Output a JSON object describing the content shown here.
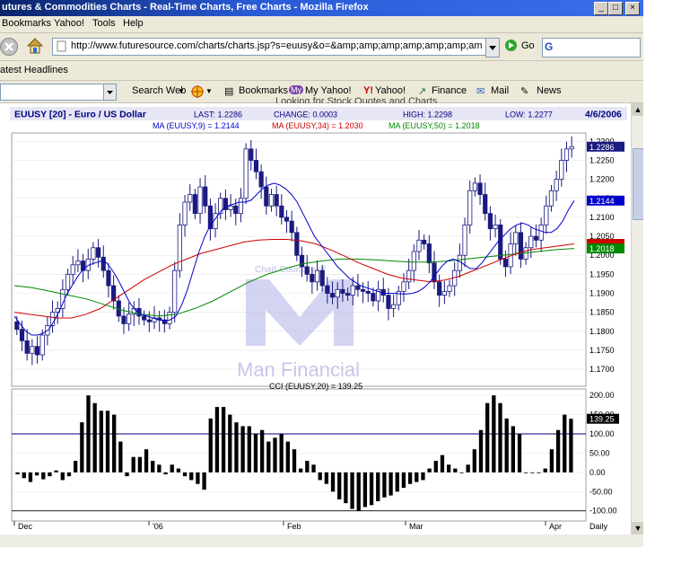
{
  "window": {
    "title": "utures & Commodities Charts - Real-Time Charts, Free Charts - Mozilla Firefox"
  },
  "menu": [
    "Bookmarks",
    "Yahoo!",
    "Tools",
    "Help"
  ],
  "nav": {
    "url": "http://www.futuresource.com/charts/charts.jsp?s=euusy&o=&amp;amp;amp;amp;amp;amp;amp;amp;amp;a=",
    "go_label": "Go"
  },
  "bookmarks_bar": {
    "item": "atest Headlines"
  },
  "yahoo_toolbar": {
    "search_label": "Search Web",
    "items": [
      "Bookmarks",
      "My Yahoo!",
      "Yahoo!",
      "Finance",
      "Mail",
      "News"
    ],
    "hint": "Looking for Stock Quotes and Charts"
  },
  "chart_header": {
    "symbol": "EUUSY [20] - Euro / US Dollar",
    "last": "LAST: 1.2286",
    "change": "CHANGE: 0.0003",
    "high": "HIGH: 1.2298",
    "low": "LOW: 1.2277",
    "date": "4/6/2006",
    "ma9": "MA (EUUSY,9) = 1.2144",
    "ma34": "MA (EUUSY,34) = 1.2030",
    "ma50": "MA (EUUSY,50) = 1.2018"
  },
  "watermark": {
    "line1": "Chart Courtesy of",
    "brand": "Man Financial"
  },
  "cci_label": "CCI (EUUSY,20) = 139.25",
  "colors": {
    "candle": "#1a1a80",
    "ma9": "#0000cc",
    "ma34": "#cc0000",
    "ma50": "#008800",
    "cci": "#000000"
  },
  "chart_data": [
    {
      "type": "candlestick",
      "title": "EUUSY [20] - Euro / US Dollar",
      "y_ticks": [
        "1.2300",
        "1.2250",
        "1.2200",
        "1.2150",
        "1.2100",
        "1.2050",
        "1.2000",
        "1.1950",
        "1.1900",
        "1.1850",
        "1.1800",
        "1.1750",
        "1.1700"
      ],
      "ylim": [
        1.166,
        1.2315
      ],
      "x_ticks": [
        "Dec",
        "'06",
        "Feb",
        "Mar",
        "Apr",
        "Daily"
      ],
      "price_markers": [
        {
          "value": 1.2286,
          "label": "1.2286",
          "color": "#1a1a80"
        },
        {
          "value": 1.2144,
          "label": "1.2144",
          "color": "#0000cc"
        },
        {
          "value": 1.203,
          "label": "",
          "color": "#cc0000"
        },
        {
          "value": 1.2018,
          "label": "1.2018",
          "color": "#008800"
        }
      ],
      "closes": [
        1.1805,
        1.1775,
        1.1742,
        1.176,
        1.1738,
        1.179,
        1.1815,
        1.185,
        1.186,
        1.191,
        1.195,
        1.1975,
        1.1985,
        1.196,
        1.199,
        1.202,
        1.1995,
        1.196,
        1.192,
        1.188,
        1.184,
        1.182,
        1.1845,
        1.186,
        1.184,
        1.183,
        1.1825,
        1.1835,
        1.183,
        1.182,
        1.185,
        1.196,
        1.208,
        1.214,
        1.216,
        1.211,
        1.218,
        1.213,
        1.207,
        1.211,
        1.215,
        1.212,
        1.213,
        1.211,
        1.215,
        1.228,
        1.225,
        1.222,
        1.218,
        1.213,
        1.216,
        1.213,
        1.21,
        1.209,
        1.206,
        1.2,
        1.197,
        1.195,
        1.193,
        1.196,
        1.192,
        1.19,
        1.189,
        1.191,
        1.19,
        1.1895,
        1.192,
        1.191,
        1.1905,
        1.19,
        1.188,
        1.191,
        1.1895,
        1.186,
        1.187,
        1.1905,
        1.193,
        1.196,
        1.201,
        1.204,
        1.203,
        1.198,
        1.193,
        1.1895,
        1.1905,
        1.192,
        1.196,
        1.2,
        1.208,
        1.217,
        1.219,
        1.216,
        1.211,
        1.207,
        1.208,
        1.199,
        1.197,
        1.203,
        1.206,
        1.199,
        1.202,
        1.205,
        1.204,
        1.208,
        1.213,
        1.217,
        1.22,
        1.225,
        1.228,
        1.2286
      ],
      "ma9": [
        1.184,
        1.182,
        1.18,
        1.179,
        1.179,
        1.1795,
        1.1805,
        1.183,
        1.186,
        1.1895,
        1.192,
        1.1945,
        1.1965,
        1.1975,
        1.198,
        1.1985,
        1.198,
        1.196,
        1.1935,
        1.1905,
        1.1875,
        1.1855,
        1.1845,
        1.184,
        1.1835,
        1.183,
        1.1828,
        1.183,
        1.184,
        1.187,
        1.191,
        1.196,
        1.201,
        1.205,
        1.208,
        1.21,
        1.212,
        1.213,
        1.2135,
        1.214,
        1.214,
        1.2145,
        1.216,
        1.2175,
        1.2185,
        1.219,
        1.2185,
        1.2175,
        1.216,
        1.214,
        1.211,
        1.208,
        1.205,
        1.203,
        1.201,
        1.199,
        1.197,
        1.1955,
        1.194,
        1.193,
        1.192,
        1.1915,
        1.191,
        1.1905,
        1.19,
        1.19,
        1.19,
        1.1898,
        1.1898,
        1.19,
        1.1905,
        1.1915,
        1.193,
        1.195,
        1.197,
        1.1985,
        1.199,
        1.1985,
        1.1975,
        1.1965,
        1.1965,
        1.198,
        1.2,
        1.202,
        1.204,
        1.2055,
        1.207,
        1.208,
        1.2085,
        1.208,
        1.207,
        1.2065,
        1.206,
        1.206,
        1.207,
        1.209,
        1.212,
        1.2144
      ],
      "ma34": [
        1.185,
        1.1845,
        1.184,
        1.1835,
        1.1835,
        1.1845,
        1.186,
        1.1885,
        1.191,
        1.1935,
        1.1955,
        1.1975,
        1.199,
        1.2005,
        1.2015,
        1.2025,
        1.2035,
        1.204,
        1.2042,
        1.2042,
        1.2038,
        1.203,
        1.2015,
        1.1998,
        1.198,
        1.1965,
        1.195,
        1.194,
        1.1935,
        1.193,
        1.1935,
        1.1945,
        1.196,
        1.1975,
        1.199,
        1.2005,
        1.2015,
        1.202,
        1.2025,
        1.203
      ],
      "ma50": [
        1.192,
        1.1915,
        1.1905,
        1.1895,
        1.1885,
        1.187,
        1.1855,
        1.1845,
        1.184,
        1.1845,
        1.186,
        1.188,
        1.1905,
        1.193,
        1.195,
        1.1965,
        1.1978,
        1.1985,
        1.199,
        1.199,
        1.1988,
        1.1985,
        1.1982,
        1.1982,
        1.1985,
        1.199,
        1.1995,
        1.2,
        1.2005,
        1.201,
        1.2015,
        1.2018
      ]
    },
    {
      "type": "bar",
      "title": "CCI (EUUSY,20) = 139.25",
      "y_ticks": [
        "200.00",
        "150.00",
        "100.00",
        "50.00",
        "0.00",
        "-50.00",
        "-100.00"
      ],
      "ylim": [
        -110,
        205
      ],
      "ref_lines": [
        100,
        -100
      ],
      "marker": {
        "value": 139.25,
        "label": "139.25"
      },
      "values": [
        -5,
        -15,
        -25,
        -8,
        -18,
        -10,
        5,
        -20,
        -10,
        30,
        130,
        200,
        180,
        160,
        160,
        150,
        80,
        -10,
        40,
        40,
        60,
        30,
        20,
        -5,
        20,
        10,
        -10,
        -20,
        -30,
        -45,
        140,
        170,
        170,
        150,
        130,
        120,
        120,
        100,
        110,
        80,
        90,
        100,
        80,
        60,
        10,
        30,
        20,
        -20,
        -30,
        -50,
        -70,
        -80,
        -95,
        -100,
        -90,
        -85,
        -75,
        -65,
        -60,
        -50,
        -40,
        -30,
        -25,
        -20,
        10,
        30,
        45,
        20,
        10,
        0,
        20,
        60,
        110,
        180,
        200,
        180,
        140,
        120,
        100,
        0,
        0,
        0,
        10,
        60,
        110,
        150,
        139.25
      ],
      "cci_text_note": ""
    }
  ]
}
